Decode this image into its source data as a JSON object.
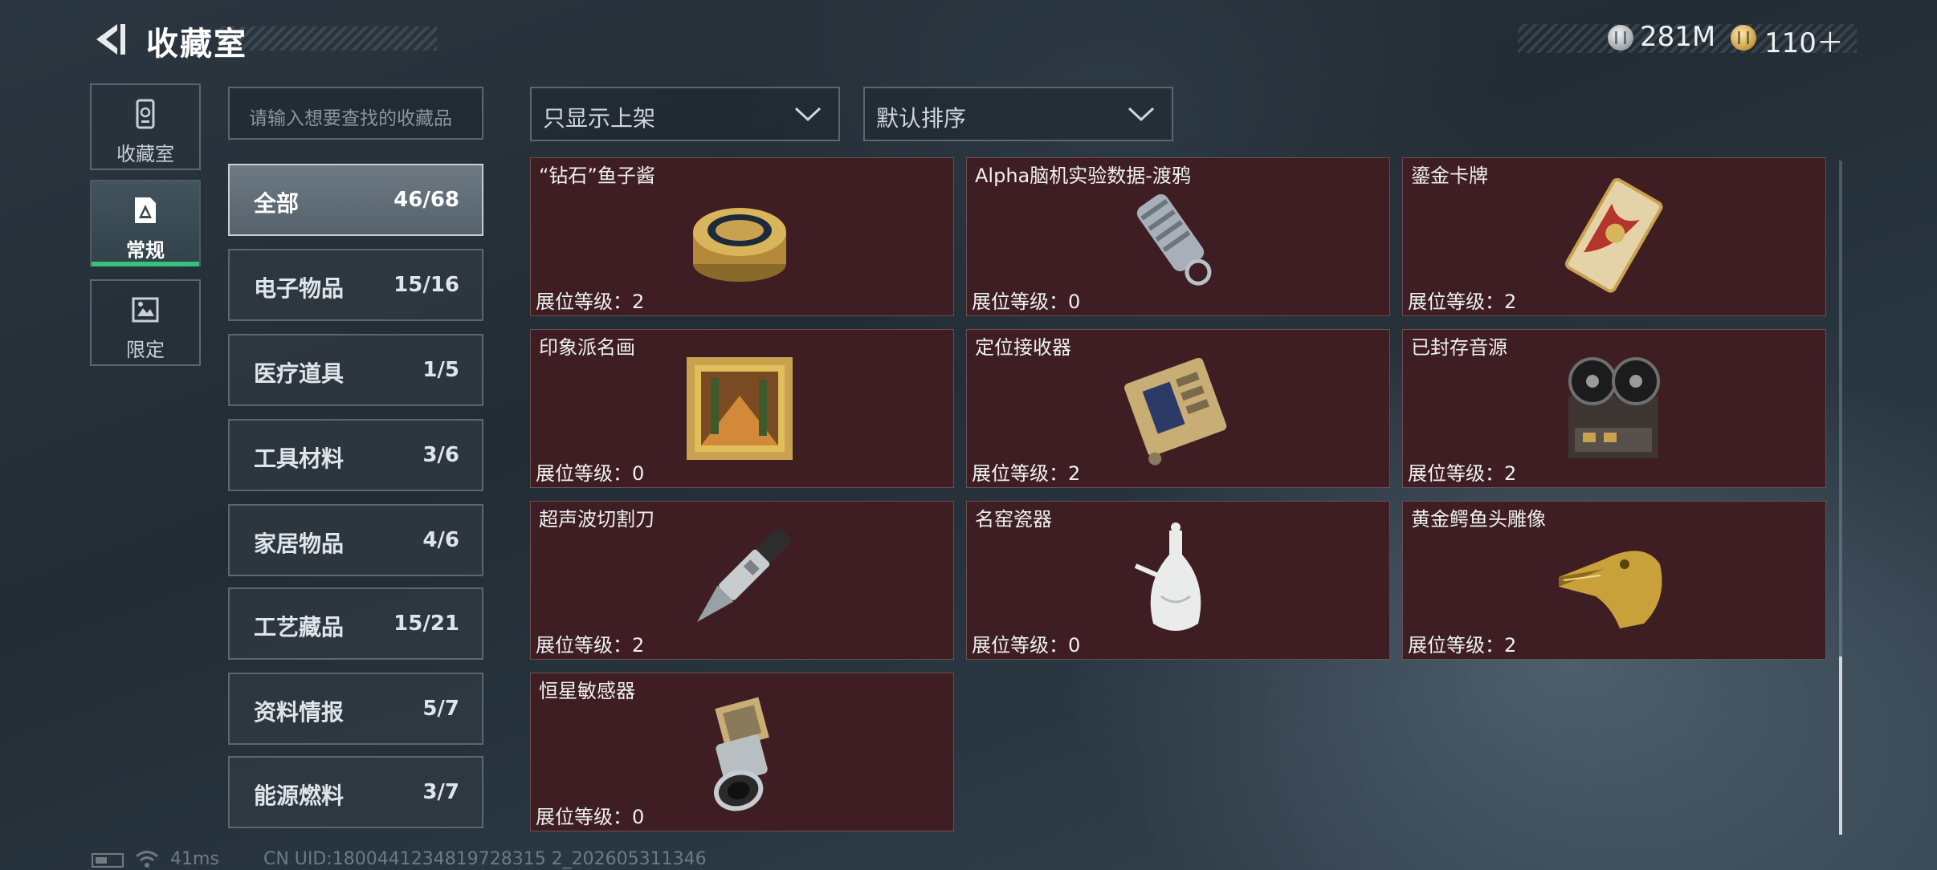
{
  "header": {
    "title": "收藏室",
    "silver_amount": "281M",
    "gold_amount": "110＋"
  },
  "side_tabs": [
    {
      "label": "收藏室",
      "icon": "cabinet-icon"
    },
    {
      "label": "常规",
      "icon": "collection-icon",
      "active": true
    },
    {
      "label": "限定",
      "icon": "limited-icon"
    }
  ],
  "search": {
    "placeholder": "请输入想要查找的收藏品"
  },
  "filters": {
    "shelf_filter": "只显示上架",
    "sort": "默认排序"
  },
  "categories": [
    {
      "name": "全部",
      "count": "46/68",
      "active": true
    },
    {
      "name": "电子物品",
      "count": "15/16"
    },
    {
      "name": "医疗道具",
      "count": "1/5"
    },
    {
      "name": "工具材料",
      "count": "3/6"
    },
    {
      "name": "家居物品",
      "count": "4/6"
    },
    {
      "name": "工艺藏品",
      "count": "15/21"
    },
    {
      "name": "资料情报",
      "count": "5/7"
    },
    {
      "name": "能源燃料",
      "count": "3/7"
    }
  ],
  "items": [
    {
      "name": "“钻石”鱼子酱",
      "level": "展位等级：2",
      "icon": "caviar-tin-icon"
    },
    {
      "name": "Alpha脑机实验数据-渡鸦",
      "level": "展位等级：0",
      "icon": "data-drive-icon"
    },
    {
      "name": "鎏金卡牌",
      "level": "展位等级：2",
      "icon": "gilded-card-icon"
    },
    {
      "name": "印象派名画",
      "level": "展位等级：0",
      "icon": "painting-icon"
    },
    {
      "name": "定位接收器",
      "level": "展位等级：2",
      "icon": "receiver-icon"
    },
    {
      "name": "已封存音源",
      "level": "展位等级：2",
      "icon": "reel-recorder-icon"
    },
    {
      "name": "超声波切割刀",
      "level": "展位等级：2",
      "icon": "ultrasonic-knife-icon"
    },
    {
      "name": "名窑瓷器",
      "level": "展位等级：0",
      "icon": "porcelain-vase-icon"
    },
    {
      "name": "黄金鳄鱼头雕像",
      "level": "展位等级：2",
      "icon": "gold-crocodile-icon"
    },
    {
      "name": "恒星敏感器",
      "level": "展位等级：0",
      "icon": "star-sensor-icon"
    }
  ],
  "footer": {
    "latency": "41ms",
    "uid": "CN UID:1800441234819728315 2_202605311346"
  }
}
